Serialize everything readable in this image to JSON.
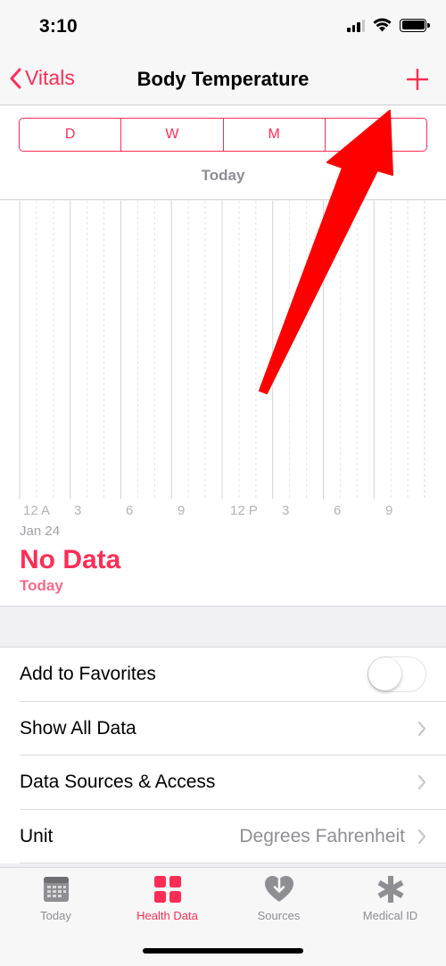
{
  "status_bar": {
    "time": "3:10"
  },
  "nav": {
    "back_label": "Vitals",
    "title": "Body Temperature"
  },
  "segments": [
    "D",
    "W",
    "M",
    "Y"
  ],
  "active_segment": 0,
  "date_label": "Today",
  "chart": {
    "tick_labels": [
      "12 A",
      "3",
      "6",
      "9",
      "12 P",
      "3",
      "6",
      "9"
    ],
    "date": "Jan 24",
    "status": "No Data",
    "status_sub": "Today"
  },
  "list": {
    "favorites_label": "Add to Favorites",
    "favorites_on": false,
    "show_all_label": "Show All Data",
    "sources_label": "Data Sources & Access",
    "unit_label": "Unit",
    "unit_value": "Degrees Fahrenheit"
  },
  "tabs": [
    {
      "label": "Today",
      "icon": "calendar-icon"
    },
    {
      "label": "Health Data",
      "icon": "grid-icon"
    },
    {
      "label": "Sources",
      "icon": "heart-download-icon"
    },
    {
      "label": "Medical ID",
      "icon": "asterisk-icon"
    }
  ],
  "active_tab": 1,
  "colors": {
    "accent": "#ff2d55",
    "arrow": "#ff0000",
    "gray": "#8e8e93"
  }
}
